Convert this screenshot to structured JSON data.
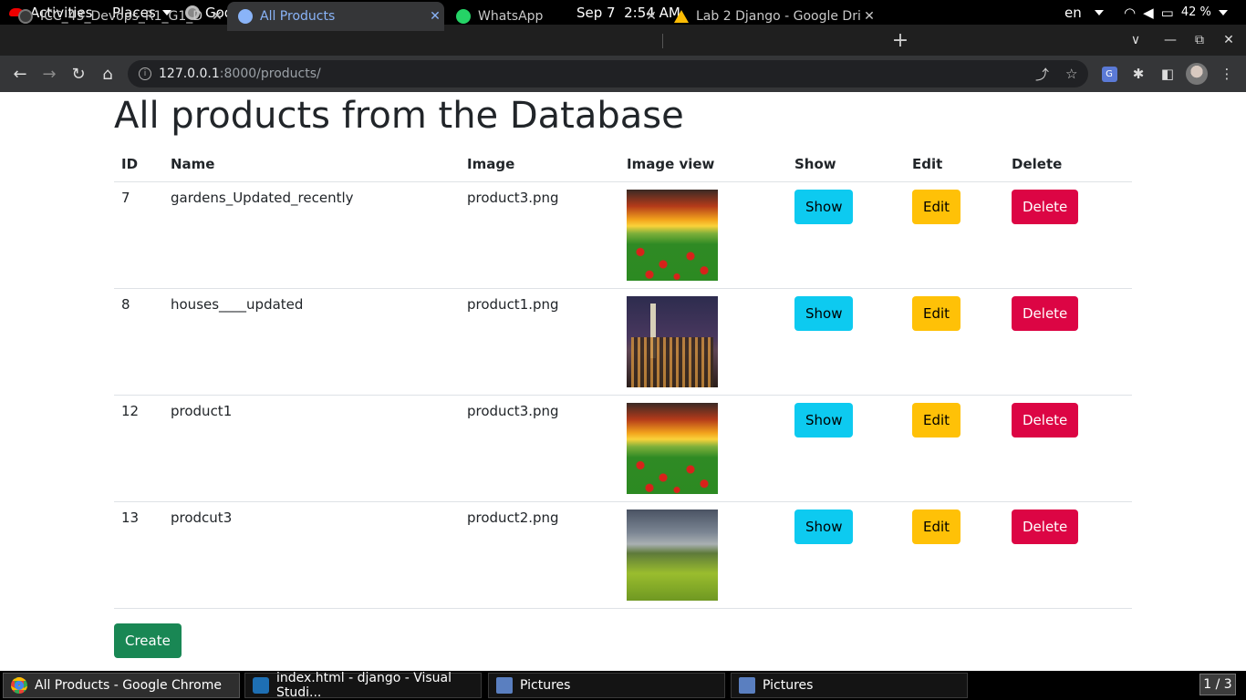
{
  "topbar": {
    "activities": "Activities",
    "places": "Places",
    "app_menu": "Google Chrome",
    "clock": "Sep 7  2:54 AM",
    "language": "en",
    "battery": "42 %"
  },
  "tabs": [
    {
      "label": "ICC_43_Devops_R1_G1_D",
      "favicon": "github-icon",
      "active": false
    },
    {
      "label": "All Products",
      "favicon": "globe-icon",
      "active": true
    },
    {
      "label": "WhatsApp",
      "favicon": "whatsapp-icon",
      "active": false
    },
    {
      "label": "Lab 2 Django - Google Dri",
      "favicon": "google-drive-icon",
      "active": false
    }
  ],
  "address_bar": {
    "host": "127.0.0.1",
    "rest": ":8000/products/"
  },
  "page": {
    "title": "All products from the Database",
    "columns": [
      "ID",
      "Name",
      "Image",
      "Image view",
      "Show",
      "Edit",
      "Delete"
    ],
    "rows": [
      {
        "id": "7",
        "name": "gardens_Updated_recently",
        "image": "product3.png",
        "thumb": "garden-image"
      },
      {
        "id": "8",
        "name": "houses____updated",
        "image": "product1.png",
        "thumb": "city-image"
      },
      {
        "id": "12",
        "name": "product1",
        "image": "product3.png",
        "thumb": "garden-image"
      },
      {
        "id": "13",
        "name": "prodcut3",
        "image": "product2.png",
        "thumb": "hills-image"
      }
    ],
    "show_label": "Show",
    "edit_label": "Edit",
    "delete_label": "Delete",
    "create_label": "Create"
  },
  "taskbar": {
    "items": [
      {
        "label": "All Products - Google Chrome",
        "icon": "chrome-icon"
      },
      {
        "label": "index.html - django - Visual Studi...",
        "icon": "vscode-icon"
      },
      {
        "label": "Pictures",
        "icon": "files-icon"
      },
      {
        "label": "Pictures",
        "icon": "files-icon"
      }
    ],
    "workspace": "1 / 3"
  },
  "colors": {
    "show": "#0dcaf0",
    "edit": "#ffc107",
    "delete": "#dc0544",
    "create": "#198754",
    "active_tab_text": "#8ab4f8"
  }
}
